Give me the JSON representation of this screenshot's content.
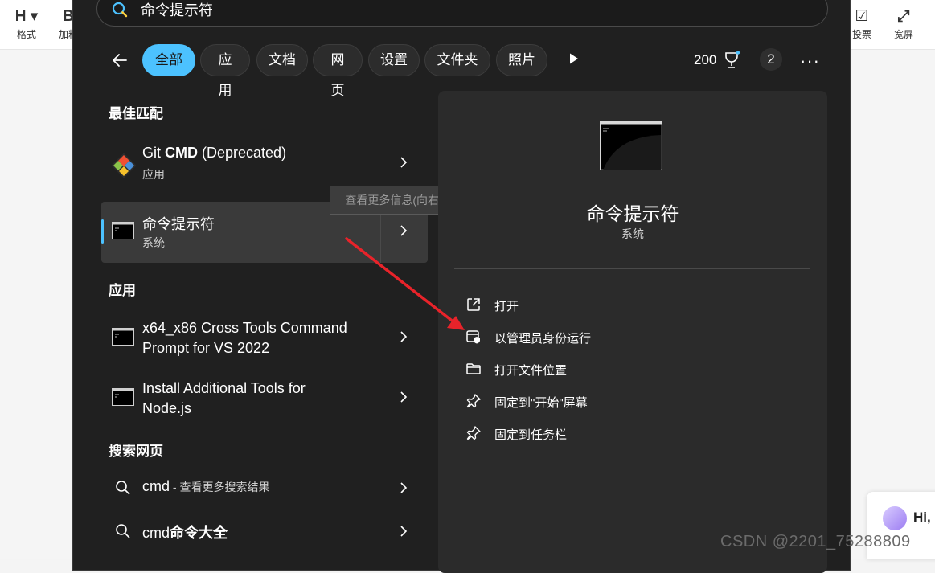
{
  "background": {
    "toolbar": [
      {
        "glyph": "H ▾",
        "label": "格式"
      },
      {
        "glyph": "B",
        "label": "加粗"
      },
      {
        "glyph": "☑",
        "label": "投票"
      },
      {
        "glyph": "⤢",
        "label": "宽屏"
      }
    ],
    "chat_greeting": "Hi,",
    "watermark": "CSDN @2201_75288809"
  },
  "search": {
    "value": "命令提示符"
  },
  "filters": [
    "全部",
    "应用",
    "文档",
    "网页",
    "设置",
    "文件夹",
    "照片"
  ],
  "active_filter": "全部",
  "header_right": {
    "points": "200",
    "badge": "2"
  },
  "sections": {
    "best_match": "最佳匹配",
    "apps": "应用",
    "web": "搜索网页"
  },
  "best_match": [
    {
      "title_plain": "Git ",
      "title_bold": "CMD",
      "title_rest": " (Deprecated)",
      "subtitle": "应用"
    },
    {
      "title": "命令提示符",
      "subtitle": "系统"
    }
  ],
  "tooltip": "查看更多信息(向右键)",
  "apps": [
    {
      "line1": "x64_x86 Cross Tools Command",
      "line2": "Prompt for VS 2022"
    },
    {
      "line1": "Install Additional Tools for",
      "line2": "Node.js"
    }
  ],
  "web": [
    {
      "query": "cmd",
      "suffix": " - 查看更多搜索结果"
    },
    {
      "query_plain": "cmd",
      "query_bold": "命令大全"
    }
  ],
  "detail": {
    "title": "命令提示符",
    "subtitle": "系统",
    "actions": [
      {
        "icon": "open-external-icon",
        "label": "打开"
      },
      {
        "icon": "shield-admin-icon",
        "label": "以管理员身份运行"
      },
      {
        "icon": "folder-icon",
        "label": "打开文件位置"
      },
      {
        "icon": "pin-icon",
        "label": "固定到\"开始\"屏幕"
      },
      {
        "icon": "pin-icon",
        "label": "固定到任务栏"
      }
    ]
  },
  "colors": {
    "accent": "#4cc2ff",
    "panel": "#202020",
    "detail_panel": "#2b2b2b",
    "arrow": "#e8232a"
  }
}
